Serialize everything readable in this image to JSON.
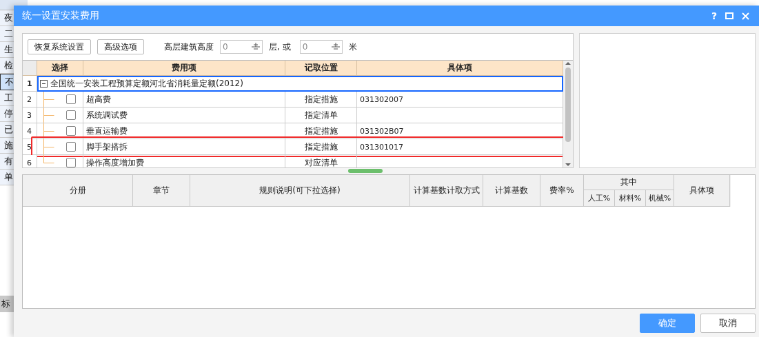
{
  "background_sheet": {
    "cells": [
      {
        "text": "夜",
        "selected": false
      },
      {
        "text": "二",
        "selected": false
      },
      {
        "text": "生",
        "selected": false
      },
      {
        "text": "检",
        "selected": false
      },
      {
        "text": "不",
        "selected": true
      },
      {
        "text": "工",
        "selected": false
      },
      {
        "text": "停",
        "selected": false
      },
      {
        "text": "已",
        "selected": false
      },
      {
        "text": "施",
        "selected": false
      },
      {
        "text": "有",
        "selected": false
      },
      {
        "text": "单",
        "selected": false
      }
    ],
    "tab": "标"
  },
  "dialog": {
    "title": "统一设置安装费用",
    "help": "?",
    "toolbar": {
      "buttons": [
        "恢复系统设置",
        "高级选项"
      ],
      "height_label": "高层建筑高度",
      "floors": {
        "value": "0",
        "unit": "层, 或"
      },
      "meters": {
        "value": "0",
        "unit": "米"
      }
    },
    "grid": {
      "columns": [
        "选择",
        "费用项",
        "记取位置",
        "具体项"
      ],
      "rows": [
        {
          "number": "1",
          "kind": "group",
          "label": "全国统一安装工程预算定额河北省消耗量定额(2012)",
          "expanded": true,
          "selected": true
        },
        {
          "number": "2",
          "kind": "item",
          "checked": false,
          "name": "超高费",
          "location": "指定措施",
          "detail": "031302007",
          "highlighted": false
        },
        {
          "number": "3",
          "kind": "item",
          "checked": false,
          "name": "系统调试费",
          "location": "指定清单",
          "detail": "",
          "highlighted": false
        },
        {
          "number": "4",
          "kind": "item",
          "checked": false,
          "name": "垂直运输费",
          "location": "指定措施",
          "detail": "031302B07",
          "highlighted": false
        },
        {
          "number": "5",
          "kind": "item",
          "checked": false,
          "name": "脚手架搭拆",
          "location": "指定措施",
          "detail": "031301017",
          "highlighted": true
        },
        {
          "number": "6",
          "kind": "item",
          "checked": false,
          "name": "操作高度增加费",
          "location": "对应清单",
          "detail": "",
          "highlighted": false
        }
      ]
    },
    "rules_table": {
      "columns": [
        "分册",
        "章节",
        "规则说明(可下拉选择)",
        "计算基数计取方式",
        "计算基数",
        "费率%"
      ],
      "group": {
        "label": "其中",
        "columns": [
          "人工%",
          "材料%",
          "机械%"
        ]
      },
      "last_column": "具体项"
    },
    "buttons": [
      {
        "label": "确定",
        "kind": "confirm"
      },
      {
        "label": "取消",
        "kind": "cancel"
      }
    ]
  }
}
